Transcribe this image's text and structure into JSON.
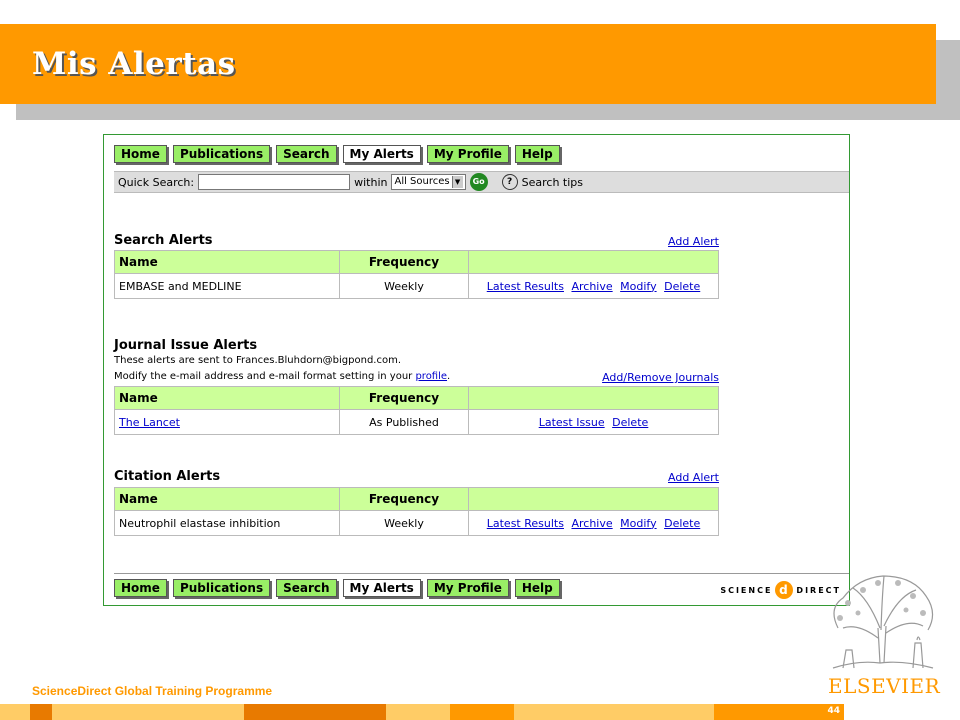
{
  "slide": {
    "title": "Mis Alertas",
    "footer": "ScienceDirect Global Training Programme",
    "page_number": "44",
    "publisher": "ELSEVIER"
  },
  "nav": [
    "Home",
    "Publications",
    "Search",
    "My Alerts",
    "My Profile",
    "Help"
  ],
  "quick_search": {
    "label": "Quick Search:",
    "value": "",
    "within_label": "within",
    "source": "All Sources",
    "go": "Go",
    "tips": "Search tips"
  },
  "search_alerts": {
    "title": "Search Alerts",
    "add_link": "Add Alert",
    "headers": [
      "Name",
      "Frequency",
      ""
    ],
    "rows": [
      {
        "name": "EMBASE and MEDLINE",
        "frequency": "Weekly",
        "actions": [
          "Latest Results",
          "Archive",
          "Modify",
          "Delete"
        ]
      }
    ]
  },
  "journal_alerts": {
    "title": "Journal Issue Alerts",
    "note1": "These alerts are sent to Frances.Bluhdorn@bigpond.com.",
    "note2_pre": "Modify the e-mail address and e-mail format setting in your",
    "note2_link": "profile",
    "note2_post": ".",
    "add_link": "Add/Remove Journals",
    "headers": [
      "Name",
      "Frequency",
      ""
    ],
    "rows": [
      {
        "name": "The Lancet",
        "frequency": "As Published",
        "actions": [
          "Latest Issue",
          "Delete"
        ]
      }
    ]
  },
  "citation_alerts": {
    "title": "Citation Alerts",
    "add_link": "Add Alert",
    "headers": [
      "Name",
      "Frequency",
      ""
    ],
    "rows": [
      {
        "name": "Neutrophil elastase inhibition",
        "frequency": "Weekly",
        "actions": [
          "Latest Results",
          "Archive",
          "Modify",
          "Delete"
        ]
      }
    ]
  },
  "brand": {
    "left": "SCIENCE",
    "mark": "d",
    "right": "DIRECT"
  },
  "colors": {
    "title_bar": "#ff9900",
    "nav_button": "#99ee66",
    "table_header": "#ccff99",
    "link": "#0000cc"
  }
}
